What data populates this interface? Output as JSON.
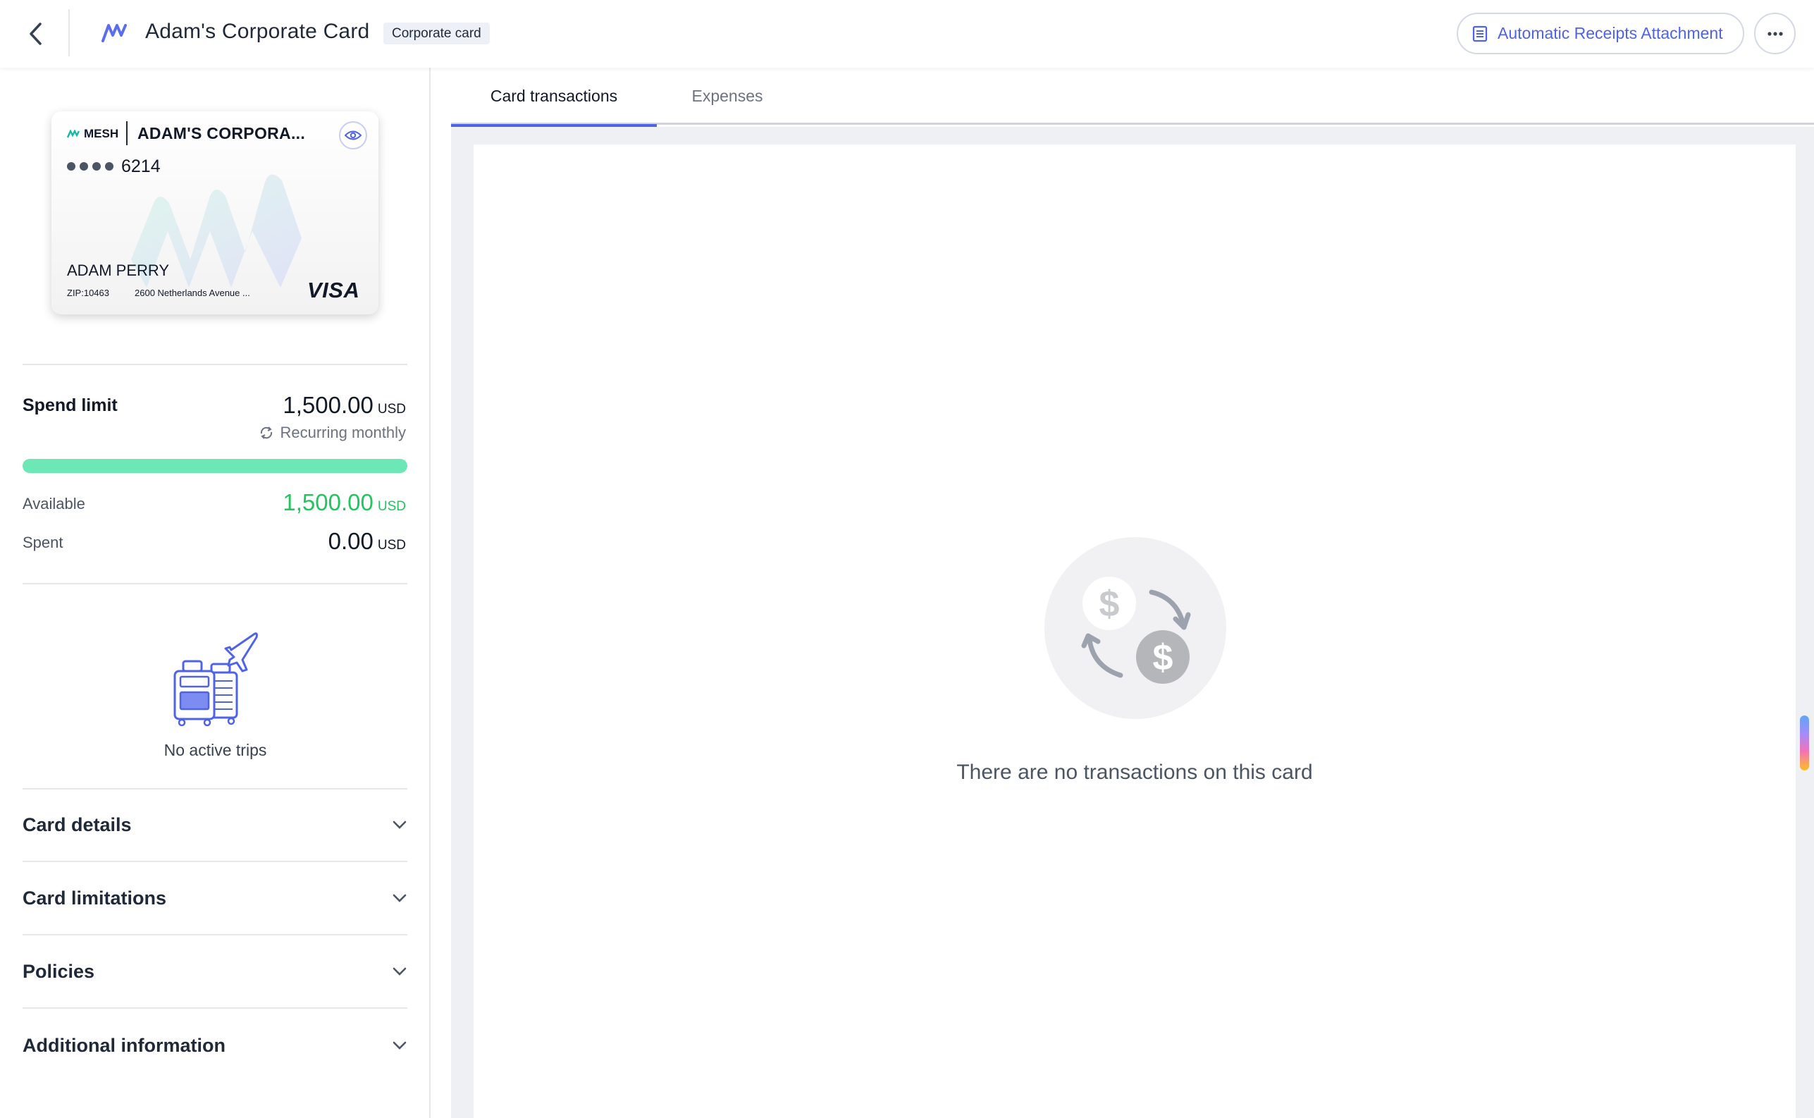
{
  "header": {
    "title": "Adam's Corporate Card",
    "badge": "Corporate card",
    "receipts_button": "Automatic Receipts Attachment"
  },
  "card": {
    "brand": "MESH",
    "name": "ADAM'S CORPORA...",
    "last4": "6214",
    "holder": "ADAM PERRY",
    "zip": "ZIP:10463",
    "address": "2600 Netherlands Avenue ...",
    "network": "VISA"
  },
  "spend": {
    "label": "Spend limit",
    "limit": "1,500.00",
    "currency": "USD",
    "recurring": "Recurring monthly",
    "available_fraction": 1.0,
    "available_label": "Available",
    "available": "1,500.00",
    "spent_label": "Spent",
    "spent": "0.00"
  },
  "trips": {
    "empty_text": "No active trips"
  },
  "accordion": [
    {
      "label": "Card details"
    },
    {
      "label": "Card limitations"
    },
    {
      "label": "Policies"
    },
    {
      "label": "Additional information"
    }
  ],
  "tabs": [
    {
      "label": "Card transactions",
      "active": true
    },
    {
      "label": "Expenses",
      "active": false
    }
  ],
  "empty_state": {
    "text": "There are no transactions on this card"
  },
  "colors": {
    "accent": "#4f63e8",
    "available_green": "#22c55e",
    "progress_fill": "#6ee7b7"
  },
  "icons": {
    "back": "chevron-left-icon",
    "brand": "mesh-logo-icon",
    "receipts": "document-list-icon",
    "more": "ellipsis-icon",
    "card_reveal": "eye-icon",
    "recurring": "recurring-icon",
    "trips": "luggage-plane-icon",
    "accordion": "chevron-down-icon",
    "empty": "dollar-exchange-icon"
  }
}
